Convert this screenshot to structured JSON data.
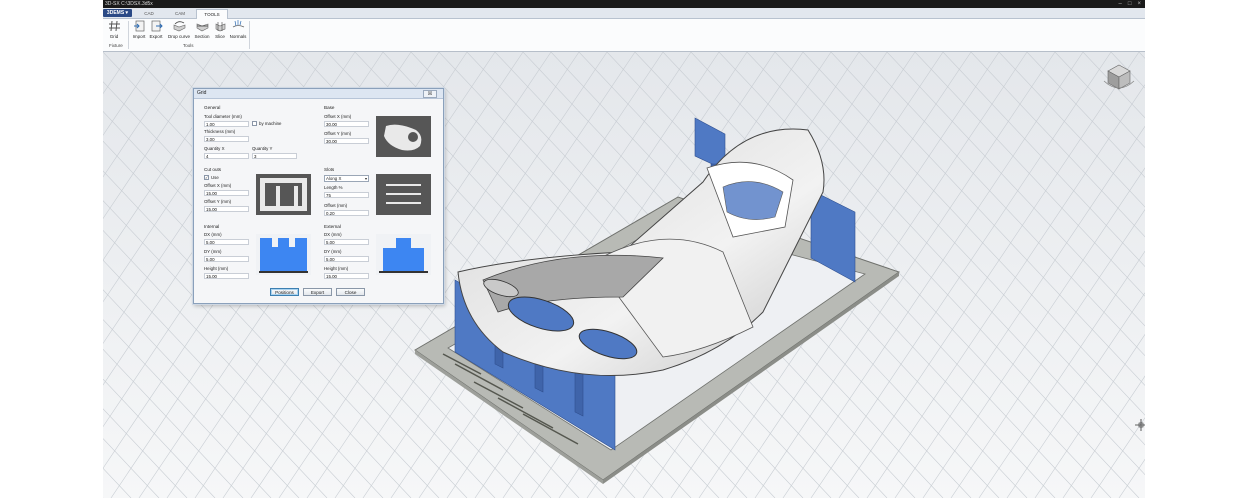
{
  "window": {
    "title": "3D-SX C:\\3DSX.3d5x",
    "buttons": [
      "–",
      "□",
      "×"
    ]
  },
  "app_menu": {
    "label": "3DEMS ▾"
  },
  "tabs": [
    {
      "label": "CAD",
      "active": false
    },
    {
      "label": "CAM",
      "active": false
    },
    {
      "label": "TOOLS",
      "active": true
    }
  ],
  "ribbon": {
    "fixture_group": {
      "title": "Fixture",
      "tools": [
        {
          "label": "Grid",
          "icon": "grid-icon"
        }
      ]
    },
    "tools_group": {
      "title": "Tools",
      "tools": [
        {
          "label": "Import",
          "icon": "import-icon"
        },
        {
          "label": "Export",
          "icon": "export-icon"
        },
        {
          "label": "Drop curve",
          "icon": "drop-curve-icon"
        },
        {
          "label": "Section",
          "icon": "section-icon"
        },
        {
          "label": "Slice",
          "icon": "slice-icon"
        },
        {
          "label": "Normals",
          "icon": "normals-icon"
        }
      ]
    }
  },
  "dialog": {
    "title": "Grid",
    "close_label": "☒",
    "general": {
      "title": "General",
      "tool_diameter_label": "Tool diameter (mm)",
      "tool_diameter": "1.00",
      "by_machine_label": "by machine",
      "by_machine_checked": false,
      "thickness_label": "Thickness (mm)",
      "thickness": "3.00",
      "quantity_x_label": "Quantity X",
      "quantity_x": "4",
      "quantity_y_label": "Quantity Y",
      "quantity_y": "3"
    },
    "base": {
      "title": "Base",
      "offset_x_label": "Offset X (mm)",
      "offset_x": "30.00",
      "offset_y_label": "Offset Y (mm)",
      "offset_y": "30.00"
    },
    "cutouts": {
      "title": "Cut outs",
      "use_label": "Use",
      "use_checked": true,
      "offset_x_label": "Offset X (mm)",
      "offset_x": "15.00",
      "offset_y_label": "Offset Y (mm)",
      "offset_y": "15.00"
    },
    "slots": {
      "title": "Slots",
      "mode": "Along X",
      "length_label": "Length %",
      "length": "75",
      "offset_label": "Offset (mm)",
      "offset": "0.20"
    },
    "internal": {
      "title": "Internal",
      "dx_label": "DX (mm)",
      "dx": "5.00",
      "dy_label": "DY (mm)",
      "dy": "5.00",
      "height_label": "Height (mm)",
      "height": "15.00"
    },
    "external": {
      "title": "External",
      "dx_label": "DX (mm)",
      "dx": "5.00",
      "dy_label": "DY (mm)",
      "dy": "5.00",
      "height_label": "Height (mm)",
      "height": "15.00"
    },
    "buttons": {
      "positions": "Positions",
      "export": "Export",
      "close": "Close"
    }
  },
  "colors": {
    "accent": "#2b4a86",
    "rib_blue": "#4f79c4",
    "base_gray": "#b9bcb6",
    "preview_blue": "#3d86f2"
  }
}
